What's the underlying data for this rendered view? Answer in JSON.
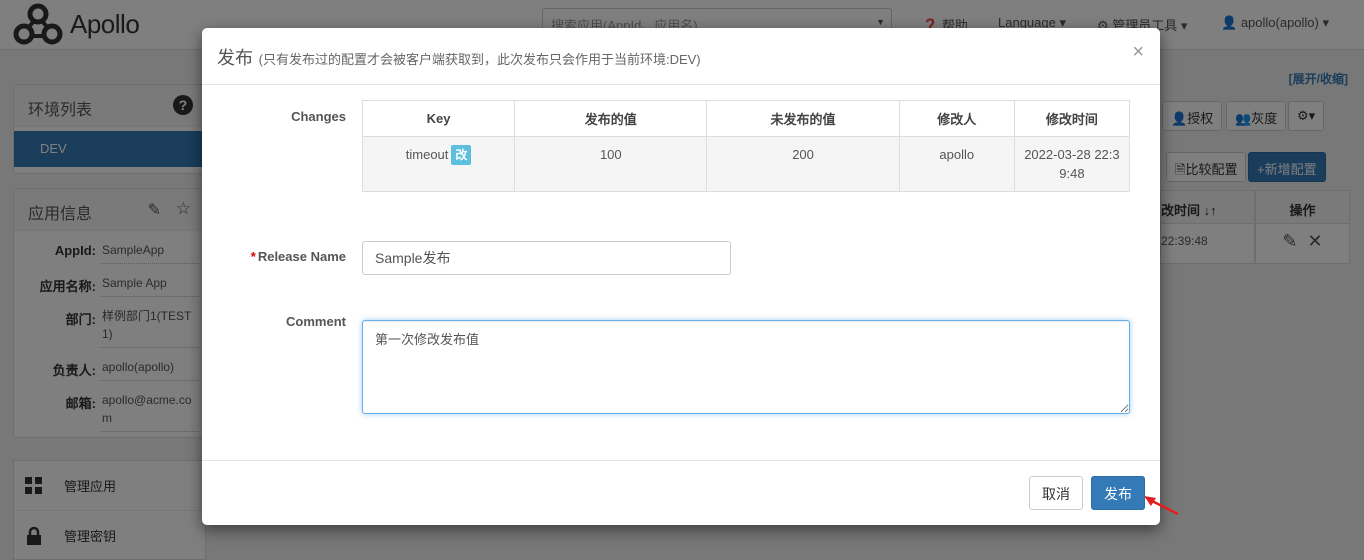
{
  "nav": {
    "logo_text": "Apollo",
    "search_placeholder": "搜索应用(AppId、应用名)",
    "help": "帮助",
    "language": "Language",
    "admin_tools": "管理员工具",
    "user": "apollo(apollo)"
  },
  "expand_link": "[展开/收缩]",
  "env_panel": {
    "title": "环境列表",
    "env": "DEV"
  },
  "app_info": {
    "title": "应用信息",
    "rows": [
      {
        "label": "AppId:",
        "value": "SampleApp"
      },
      {
        "label": "应用名称:",
        "value": "Sample App"
      },
      {
        "label": "部门:",
        "value": "样例部门1(TEST1)"
      },
      {
        "label": "负责人:",
        "value": "apollo(apollo)"
      },
      {
        "label": "邮箱:",
        "value": "apollo@acme.com"
      }
    ]
  },
  "side_menu": {
    "manage_app": "管理应用",
    "manage_keys": "管理密钥"
  },
  "toolbar": {
    "authorize": "授权",
    "gray": "灰度",
    "compare": "比较配置",
    "add_config": "新增配置"
  },
  "bg_table": {
    "col_modified_time": "改时间",
    "col_actions": "操作",
    "cell_time": "22:39:48"
  },
  "modal": {
    "title": "发布",
    "subtitle": "(只有发布过的配置才会被客户端获取到，此次发布只会作用于当前环境:DEV)",
    "changes_label": "Changes",
    "columns": [
      "Key",
      "发布的值",
      "未发布的值",
      "修改人",
      "修改时间"
    ],
    "rows": [
      {
        "key": "timeout",
        "badge": "改",
        "released": "100",
        "unreleased": "200",
        "modifier": "apollo",
        "time": "2022-03-28 22:39:48"
      }
    ],
    "release_name_label": "Release Name",
    "release_name_value": "Sample发布",
    "comment_label": "Comment",
    "comment_value": "第一次修改发布值",
    "cancel": "取消",
    "publish": "发布"
  },
  "colors": {
    "primary": "#337ab7",
    "badge": "#5bc0de",
    "arrow": "#e02020"
  }
}
